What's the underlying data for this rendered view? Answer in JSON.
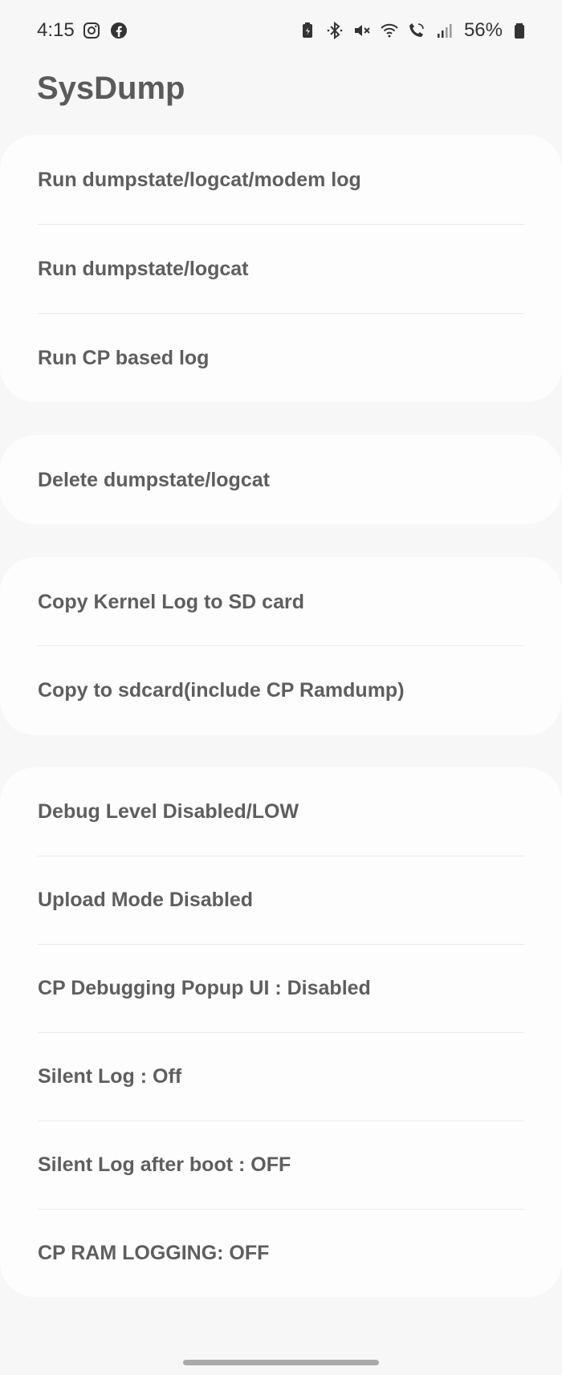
{
  "status_bar": {
    "time": "4:15",
    "left_icons": [
      "instagram-icon",
      "facebook-icon"
    ],
    "right_icons": [
      "battery-saver-icon",
      "bluetooth-icon",
      "mute-icon",
      "wifi-icon",
      "wifi-call-icon",
      "signal-icon"
    ],
    "battery": "56%"
  },
  "title": "SysDump",
  "groups": [
    {
      "items": [
        "Run dumpstate/logcat/modem log",
        "Run dumpstate/logcat",
        "Run CP based log"
      ]
    },
    {
      "items": [
        "Delete dumpstate/logcat"
      ]
    },
    {
      "items": [
        "Copy Kernel Log to SD card",
        "Copy to sdcard(include CP Ramdump)"
      ]
    },
    {
      "items": [
        "Debug Level Disabled/LOW",
        "Upload Mode Disabled",
        "CP Debugging Popup UI : Disabled",
        "Silent Log : Off",
        "Silent Log after boot : OFF",
        "CP RAM LOGGING: OFF"
      ]
    }
  ]
}
